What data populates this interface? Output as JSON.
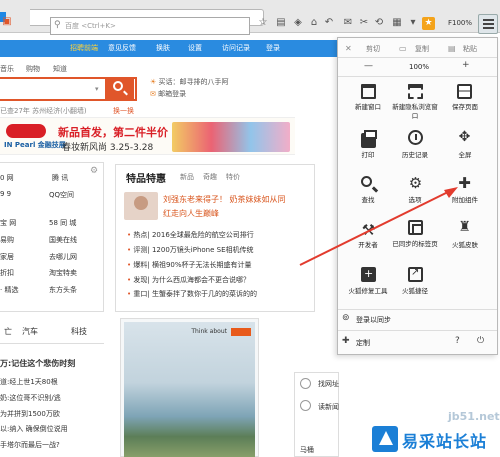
{
  "toolbar": {
    "search_placeholder": "百度 <Ctrl+K>",
    "zoom_label": "F100%",
    "star_glyph": "★"
  },
  "navbar": {
    "items": [
      "招聘前端",
      "意见反馈",
      "换肤",
      "设置",
      "访问记录",
      "登录"
    ]
  },
  "categories": [
    "音乐",
    "购物",
    "知道"
  ],
  "search": {
    "change_label": "换一换"
  },
  "weather": {
    "text": "已查27年 苏州经济(小翻墙)"
  },
  "mail": {
    "line1": "买话：邮寻排的八手阿",
    "line2": "邮箱登录"
  },
  "banner": {
    "brand": "IN Pearl 金融技展",
    "title": "新品首发，第二件半价",
    "subtitle": "春妆新风尚 3.25-3.28"
  },
  "left_links": [
    [
      "0 网",
      "腾 讯"
    ],
    [
      "9 9",
      "QQ空间"
    ],
    [
      "宝 网",
      "58 同 城"
    ],
    [
      "易购",
      "国美在线"
    ],
    [
      "家居",
      "去哪儿网"
    ],
    [
      "折扣",
      "淘宝特卖"
    ],
    [
      "· 精选",
      "东方头条"
    ]
  ],
  "tabs": {
    "left": "亡",
    "auto": "汽车",
    "tech": "科技"
  },
  "news": [
    "万:记住这个悲伤时刻",
    "道:经上世1天80根",
    "奶:这位哥不识别/逃",
    "为并拼到1500万欧",
    "以:纳入 确保倒位说用",
    "手塔尔而最后一战?"
  ],
  "feature": {
    "title": "特品特惠",
    "subs": [
      "新品",
      "奇趣",
      "特价"
    ],
    "headline1": "刘强东老来得子！ 奶茶妹妹如从同",
    "headline2": "红走向人生巅峰",
    "bullets": [
      "热点| 2016全球最危险的航空公司排行",
      "评测| 1200万镜头iPhone SE相机传统",
      "爆料| 横祖90%杯子无法长期盛有计量",
      "发现| 为什么西瓜海都会不更合说哪？",
      "重口| 生蟹泰拌了数你于几的的菜诉的的"
    ]
  },
  "ad": {
    "logo_text": "Think about"
  },
  "sidebar": {
    "items": [
      "找网址",
      "读新闻",
      "马桶"
    ]
  },
  "menu": {
    "edit": {
      "cut": "剪切",
      "copy": "复制",
      "paste": "粘贴"
    },
    "zoom": {
      "minus": "—",
      "value": "100%",
      "plus": "+"
    },
    "grid": [
      {
        "name": "new-window",
        "label": "新建窗口"
      },
      {
        "name": "new-private-window",
        "label": "新建隐私浏览窗口"
      },
      {
        "name": "save-page",
        "label": "保存页面"
      },
      {
        "name": "print",
        "label": "打印"
      },
      {
        "name": "history",
        "label": "历史记录"
      },
      {
        "name": "fullscreen",
        "label": "全屏"
      },
      {
        "name": "find",
        "label": "查找"
      },
      {
        "name": "options",
        "label": "选项"
      },
      {
        "name": "addons",
        "label": "附加组件"
      },
      {
        "name": "developer",
        "label": "开发者"
      },
      {
        "name": "synced-tabs",
        "label": "已同步的标签页"
      },
      {
        "name": "skins",
        "label": "火狐皮肤"
      },
      {
        "name": "repair-tool",
        "label": "火狐修复工具"
      },
      {
        "name": "share",
        "label": "火狐捷径"
      }
    ],
    "sync_label": "登录以同步",
    "customize_label": "定制",
    "help_glyph": "?",
    "power_glyph": "⏻"
  },
  "watermark": {
    "text": "易采站长站",
    "url": "jb51.net"
  }
}
